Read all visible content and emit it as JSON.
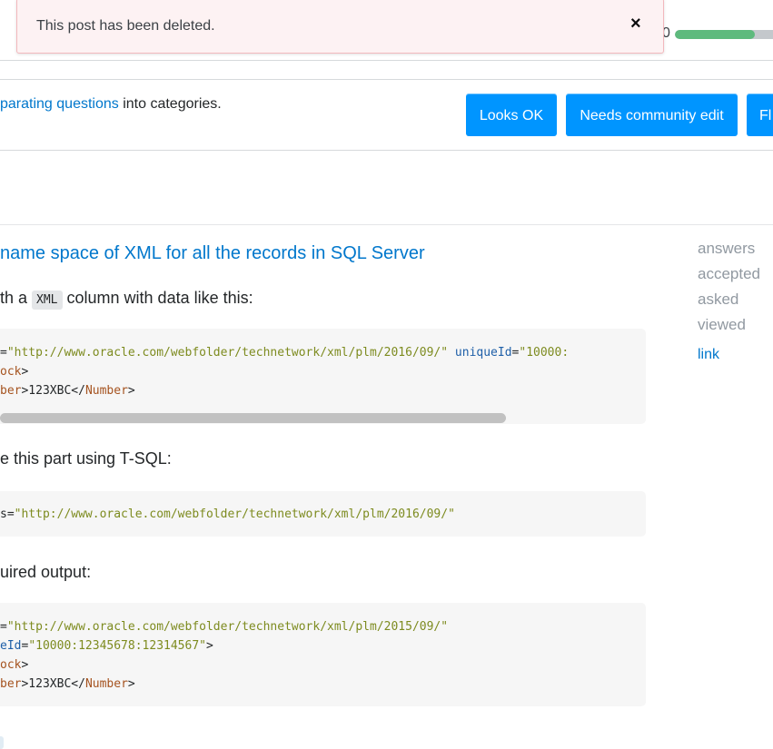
{
  "toast": {
    "message": "This post has been deleted.",
    "close_icon": "×"
  },
  "progress": {
    "label": "0",
    "percent": 73,
    "color": "#5eba7d"
  },
  "review": {
    "info_link": "parating questions",
    "info_rest": " into categories.",
    "buttons": [
      "Looks OK",
      "Needs community edit",
      "Fl"
    ]
  },
  "question": {
    "title": "name space of XML for all the records in SQL Server",
    "p1_before": "th a ",
    "p1_code": "XML",
    "p1_after": " column with data like this:",
    "p2": "e this part using T-SQL:",
    "p3": "uired output:",
    "code_blocks": [
      [
        [
          {
            "t": "=",
            "c": "txt"
          },
          {
            "t": "\"http://www.oracle.com/webfolder/technetwork/xml/plm/2016/09/\"",
            "c": "str"
          },
          {
            "t": " uniqueId",
            "c": "attr"
          },
          {
            "t": "=",
            "c": "txt"
          },
          {
            "t": "\"10000:",
            "c": "str"
          }
        ],
        [
          {
            "t": "ock",
            "c": "tag"
          },
          {
            "t": ">",
            "c": "txt"
          }
        ],
        [
          {
            "t": "ber",
            "c": "tag"
          },
          {
            "t": ">123XBC</",
            "c": "txt"
          },
          {
            "t": "Number",
            "c": "tag"
          },
          {
            "t": ">",
            "c": "txt"
          }
        ]
      ],
      [
        [
          {
            "t": "s=",
            "c": "txt"
          },
          {
            "t": "\"http://www.oracle.com/webfolder/technetwork/xml/plm/2016/09/\"",
            "c": "str"
          }
        ]
      ],
      [
        [
          {
            "t": "=",
            "c": "txt"
          },
          {
            "t": "\"http://www.oracle.com/webfolder/technetwork/xml/plm/2015/09/\"",
            "c": "str"
          }
        ],
        [
          {
            "t": "eId",
            "c": "attr"
          },
          {
            "t": "=",
            "c": "txt"
          },
          {
            "t": "\"10000:12345678:12314567\"",
            "c": "str"
          },
          {
            "t": ">",
            "c": "txt"
          }
        ],
        [
          {
            "t": "ock",
            "c": "tag"
          },
          {
            "t": ">",
            "c": "txt"
          }
        ],
        [
          {
            "t": "ber",
            "c": "tag"
          },
          {
            "t": ">123XBC</",
            "c": "txt"
          },
          {
            "t": "Number",
            "c": "tag"
          },
          {
            "t": ">",
            "c": "txt"
          }
        ]
      ]
    ]
  },
  "sidebar": {
    "answers": "answers",
    "accepted": "accepted",
    "asked": "asked",
    "viewed": "viewed",
    "link": "link"
  }
}
